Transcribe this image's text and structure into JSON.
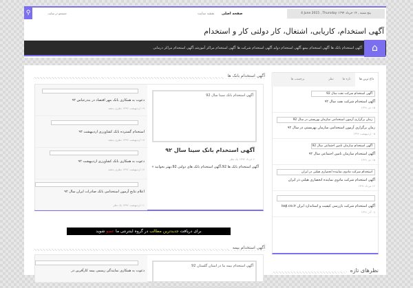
{
  "topbar": {
    "search_placeholder": "جستجو در سایت",
    "date": "4 June 2015 , Thursday  پنج شنبه , ۱۴ خرداد ۱۳۹۴",
    "links": [
      "صفحه اصلی",
      "نقشه سایت"
    ]
  },
  "site_title": "آگهی استخدام، کاریابی، اشتغال، کار دولتی  کار و استخدام",
  "nav": {
    "items": [
      "آگهی استخدام بانک ها",
      "آگهی استخدام بیمه",
      "آگهی استخدام دولتی",
      "آگهی استخدام شرکت ها",
      "آگهی استخدام مراکز آموزشی",
      "آگهی استخدام مراکز درمانی"
    ]
  },
  "sections": [
    {
      "title": "آگهی استخدام بانک ها",
      "main_post": {
        "image_alt": "آگهی استخدام بانک سینا سال 92",
        "title": "آگهی استخدام بانک سینا سال ۹۲",
        "meta": "۶ خرداد ۱۳۹۲ یک نظر",
        "excerpt": "آگهی استخدام بانک ها 92،آگهی استخدام بانک های دولتی 92،بهتر بخوانید »"
      },
      "list": [
        {
          "title": "دعوت به همکاری بانک مهر اقتصاد در بندرعباس ۹۲",
          "meta": "۱۹ اردیبهشت ۱۳۹۲ نظری بدهید"
        },
        {
          "title": "استخدام گسترده بانک کشاورزی اردیبهشت ۹۲",
          "meta": "۱۸ اردیبهشت ۱۳۹۲ نظری بدهید"
        },
        {
          "title": "دعوت به همکاری بانک کشاورزی اردیبهشت ۹۲",
          "meta": "۱۷ اردیبهشت ۱۳۹۲ نظری بدهید"
        },
        {
          "title": "اعلام نتایج آزمون استخدامی بانک صادرات ایران سال ۹۲",
          "meta": "۱۱ اردیبهشت ۱۳۹۲ یک نظر"
        }
      ]
    },
    {
      "title": "آگهی استخدام بیمه",
      "main_post": {
        "image_alt": "آگهی استخدام بیمه ما در استان گلستان 92"
      },
      "list": [
        {
          "title": "دعوت به همکاری نمایندگی رسمی بیمه کارآفرین در"
        }
      ]
    }
  ],
  "banner": {
    "part1": "برای دریافت",
    "part2": "جدیدترین مطالب",
    "part3": "در گروه اینترنتی ما",
    "part4": "عضو",
    "part5": "شوید"
  },
  "sidebar": {
    "tabs": [
      "داغ ترین ها",
      "تازه ها",
      "نظر",
      "برچسب ها"
    ],
    "items": [
      {
        "image_alt": "آگهی استخدام شرکت نفت سال 92",
        "title": "آگهی استخدام شرکت نفت سال ۹۲",
        "date": "۱۵ دی ۱۳۹۱"
      },
      {
        "image_alt": "زمان برگزاری آزمون استخدامی سازمان بهزیستی در سال 92",
        "title": "زمان برگزاری آزمون استخدامی سازمان بهزیستی در سال ۹۲",
        "date": "۰۵ اردیبهشت ۱۳۹۲"
      },
      {
        "image_alt": "آگهی استخدام سازمان تامین اجتماعی سال 92",
        "title": "آگهی استخدام سازمان تامین اجتماعی سال ۹۲",
        "date": "۱۵ دی ۱۳۹۱"
      },
      {
        "image_alt": "استخدام شرکت مادوی نماینده انحصاری هیلتی در ایران",
        "title": "آگهی استخدام شرکت مادوی نماینده انحصاری هیلتی در ایران",
        "date": "۱۲ مرداد ۱۳۹۱"
      },
      {
        "image_alt": "",
        "title": "آگهی استخدام شرکت بازرسی کیفیت و استاندارد ایران isqi.co.ir",
        "date": "۰۸ آذر ۱۳۹۱"
      }
    ],
    "comments_title": "نظرهای تازه"
  },
  "colors": {
    "accent": "#7b6ff0",
    "nav_bg": "#2a2a2a"
  }
}
